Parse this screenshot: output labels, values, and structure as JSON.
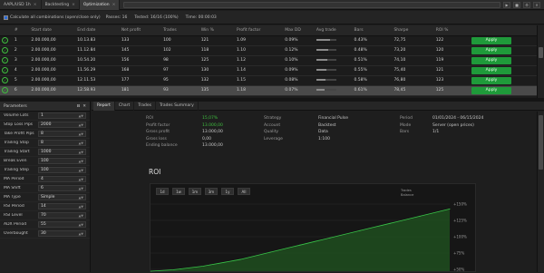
{
  "tabbar": {
    "tabs": [
      {
        "label": "AAPL/USD  1h",
        "active": false
      },
      {
        "label": "Backtesting",
        "active": false
      },
      {
        "label": "Optimization",
        "active": true
      }
    ]
  },
  "infobar": {
    "checkbox_label": "Calculate all combinations (open/close only)",
    "items": [
      "Passes: 16",
      "Tested: 16/16 (100%)",
      "Time: 00:00:03"
    ]
  },
  "grid": {
    "columns": [
      "",
      "#",
      "Start date",
      "End date",
      "Net profit",
      "Trades",
      "Win %",
      "Profit factor",
      "Max DD",
      "Avg trade",
      "Bars",
      "Sharpe",
      "ROI %",
      ""
    ],
    "rows": [
      {
        "n": "1",
        "start": "2.00.000,00",
        "end": "10.13.83",
        "profit": "133",
        "trades": "100",
        "win": "121",
        "pf": "1.09",
        "dd": "0.09%",
        "avg": "",
        "bars": "0.43%",
        "sharpe": "72,75",
        "roi": "122",
        "bar": 0.7,
        "action": "Apply",
        "selected": false
      },
      {
        "n": "2",
        "start": "2.00.000,00",
        "end": "11.12.84",
        "profit": "145",
        "trades": "102",
        "win": "118",
        "pf": "1.10",
        "dd": "0.12%",
        "avg": "",
        "bars": "0.48%",
        "sharpe": "73,20",
        "roi": "120",
        "bar": 0.6,
        "action": "Apply",
        "selected": false
      },
      {
        "n": "3",
        "start": "2.00.000,00",
        "end": "10.54.20",
        "profit": "156",
        "trades": "98",
        "win": "125",
        "pf": "1.12",
        "dd": "0.10%",
        "avg": "",
        "bars": "0.51%",
        "sharpe": "74,10",
        "roi": "119",
        "bar": 0.55,
        "action": "Apply",
        "selected": false
      },
      {
        "n": "4",
        "start": "2.00.000,00",
        "end": "11.56.29",
        "profit": "168",
        "trades": "97",
        "win": "130",
        "pf": "1.14",
        "dd": "0.09%",
        "avg": "",
        "bars": "0.55%",
        "sharpe": "75,40",
        "roi": "121",
        "bar": 0.5,
        "action": "Apply",
        "selected": false
      },
      {
        "n": "5",
        "start": "2.00.000,00",
        "end": "12.11.53",
        "profit": "177",
        "trades": "95",
        "win": "132",
        "pf": "1.15",
        "dd": "0.08%",
        "avg": "",
        "bars": "0.58%",
        "sharpe": "76,80",
        "roi": "123",
        "bar": 0.45,
        "action": "Apply",
        "selected": false
      },
      {
        "n": "6",
        "start": "2.00.000,00",
        "end": "12.58.93",
        "profit": "181",
        "trades": "93",
        "win": "135",
        "pf": "1.18",
        "dd": "0.07%",
        "avg": "",
        "bars": "0.61%",
        "sharpe": "78,45",
        "roi": "125",
        "bar": 0.4,
        "action": "Apply",
        "selected": true
      }
    ]
  },
  "params": {
    "title": "Parameters",
    "rows": [
      {
        "label": "Volume Lots",
        "value": "1"
      },
      {
        "label": "Stop Loss Pips",
        "value": "2000"
      },
      {
        "label": "Take Profit Pips",
        "value": "8"
      },
      {
        "label": "Trailing Stop",
        "value": "8"
      },
      {
        "label": "Trailing Start",
        "value": "1000"
      },
      {
        "label": "Break Even",
        "value": "100"
      },
      {
        "label": "Trailing Step",
        "value": "100"
      },
      {
        "label": "MA Period",
        "value": "4"
      },
      {
        "label": "MA Shift",
        "value": "6"
      },
      {
        "label": "MA Type",
        "value": "Simple"
      },
      {
        "label": "RSI Period",
        "value": "14"
      },
      {
        "label": "RSI Level",
        "value": "70"
      },
      {
        "label": "ADX Period",
        "value": "55"
      },
      {
        "label": "Overbought",
        "value": "30"
      }
    ]
  },
  "right_tabs": [
    "Report",
    "Chart",
    "Trades",
    "Trades Summary"
  ],
  "stats": {
    "col1": [
      {
        "k": "ROI",
        "v": "15,07%",
        "green": true
      },
      {
        "k": "Profit factor",
        "v": "13.000,00",
        "green": true
      },
      {
        "k": "Gross profit",
        "v": "13.000,00",
        "green": false
      },
      {
        "k": "Gross loss",
        "v": "0,00",
        "green": false
      },
      {
        "k": "Ending balance",
        "v": "13.000,00",
        "green": false
      }
    ],
    "col2": [
      {
        "k": "Strategy",
        "v": "Financial Pulse"
      },
      {
        "k": "Account",
        "v": "Backtest"
      },
      {
        "k": "Quality",
        "v": "Data"
      },
      {
        "k": "Leverage",
        "v": "1:100"
      }
    ],
    "col3": [
      {
        "k": "Period",
        "v": "01/01/2024 - 06/15/2024"
      },
      {
        "k": "Mode",
        "v": "Server (open prices)"
      },
      {
        "k": "Bars",
        "v": "1/1"
      }
    ]
  },
  "roi_title": "ROI",
  "chart_data": {
    "type": "area",
    "timeframes": [
      "1d",
      "1w",
      "1m",
      "3m",
      "1y",
      "All"
    ],
    "title": "",
    "xlabel": "",
    "ylabel": "",
    "legend": [
      "Trades",
      "Balance"
    ],
    "ytick_labels": [
      "+150%",
      "+125%",
      "+100%",
      "+75%",
      "+50%"
    ],
    "ylim": [
      0,
      165
    ],
    "values": [
      0,
      1,
      2,
      3,
      5,
      7,
      9,
      11,
      14,
      17,
      20,
      23,
      26,
      30,
      34,
      38,
      42,
      46,
      50,
      54,
      58,
      62,
      66,
      70,
      74,
      78,
      82,
      86,
      90,
      94,
      98,
      102,
      106,
      110,
      114,
      118,
      122,
      126,
      130,
      134,
      138
    ],
    "line_color": "#38c448",
    "fill_color": "#1e4a1e"
  }
}
